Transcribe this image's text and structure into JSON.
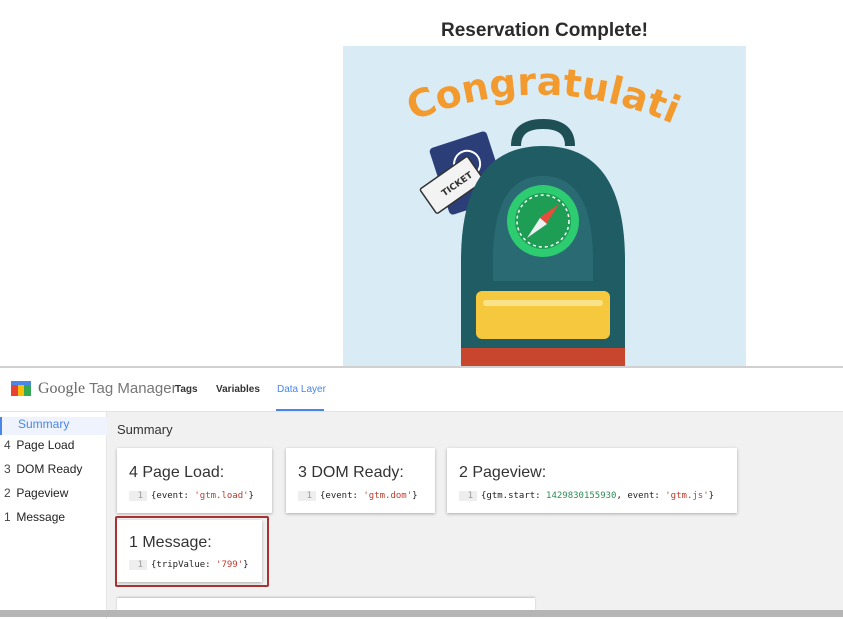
{
  "page": {
    "heading": "Reservation Complete!",
    "hero": {
      "banner_text": "Congratulations!",
      "ticket_text": "TICKET"
    }
  },
  "gtm": {
    "brand_google": "Google",
    "brand_tag_manager": "Tag Manager",
    "tabs": [
      {
        "label": "Tags",
        "active": false
      },
      {
        "label": "Variables",
        "active": false
      },
      {
        "label": "Data Layer",
        "active": true
      }
    ],
    "sidebar": [
      {
        "num": "",
        "label": "Summary",
        "active": true
      },
      {
        "num": "4",
        "label": "Page Load",
        "active": false
      },
      {
        "num": "3",
        "label": "DOM Ready",
        "active": false
      },
      {
        "num": "2",
        "label": "Pageview",
        "active": false
      },
      {
        "num": "1",
        "label": "Message",
        "active": false
      }
    ],
    "main_title": "Summary",
    "cards": [
      {
        "title": "4 Page Load:",
        "line": "1",
        "code_key": "{event: ",
        "code_val": "'gtm.load'",
        "code_end": "}"
      },
      {
        "title": "3 DOM Ready:",
        "line": "1",
        "code_key": "{event: ",
        "code_val": "'gtm.dom'",
        "code_end": "}"
      },
      {
        "title": "2 Pageview:",
        "line": "1",
        "code_key": "{gtm.start: ",
        "code_num": "1429830155930",
        "code_mid": ", event: ",
        "code_val": "'gtm.js'",
        "code_end": "}"
      },
      {
        "title": "1 Message:",
        "line": "1",
        "code_key": "{tripValue: ",
        "code_val": "'799'",
        "code_end": "}"
      }
    ],
    "colors": {
      "accent": "#4a86e8",
      "highlight_border": "#a83232",
      "string_value": "#c0392b",
      "number_value": "#2e8b57"
    }
  }
}
